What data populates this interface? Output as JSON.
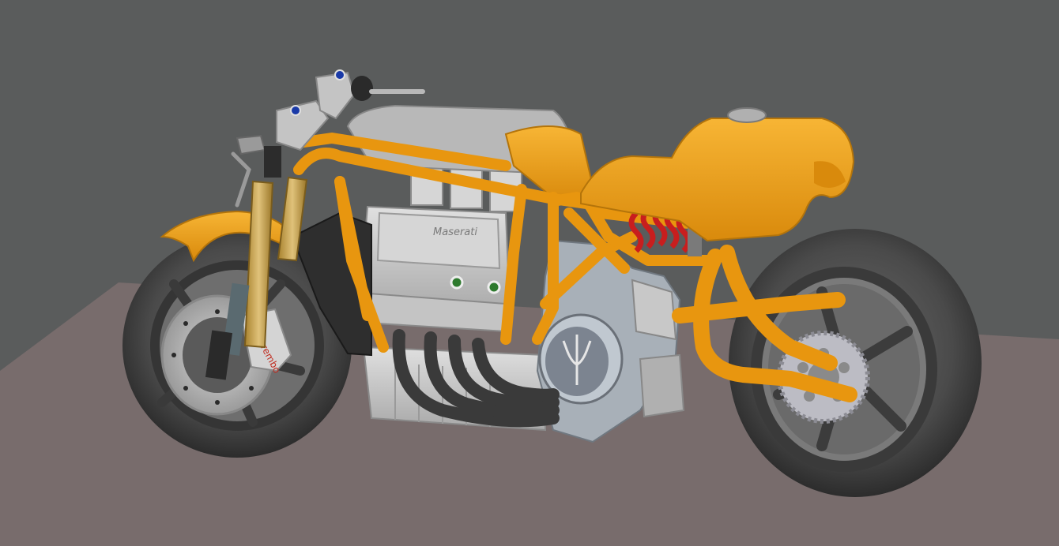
{
  "viewport": {
    "background_color": "#5a5c5c",
    "floor_color": "#786c6c"
  },
  "model": {
    "frame_color": "#f2a21a",
    "engine_color": "#c9c9c9",
    "tire_color": "#4a4a4a",
    "spring_color": "#c81e1e",
    "fork_color": "#c9a24a",
    "cam_cover_text": "Maserati",
    "caliper_text": "brembo"
  }
}
